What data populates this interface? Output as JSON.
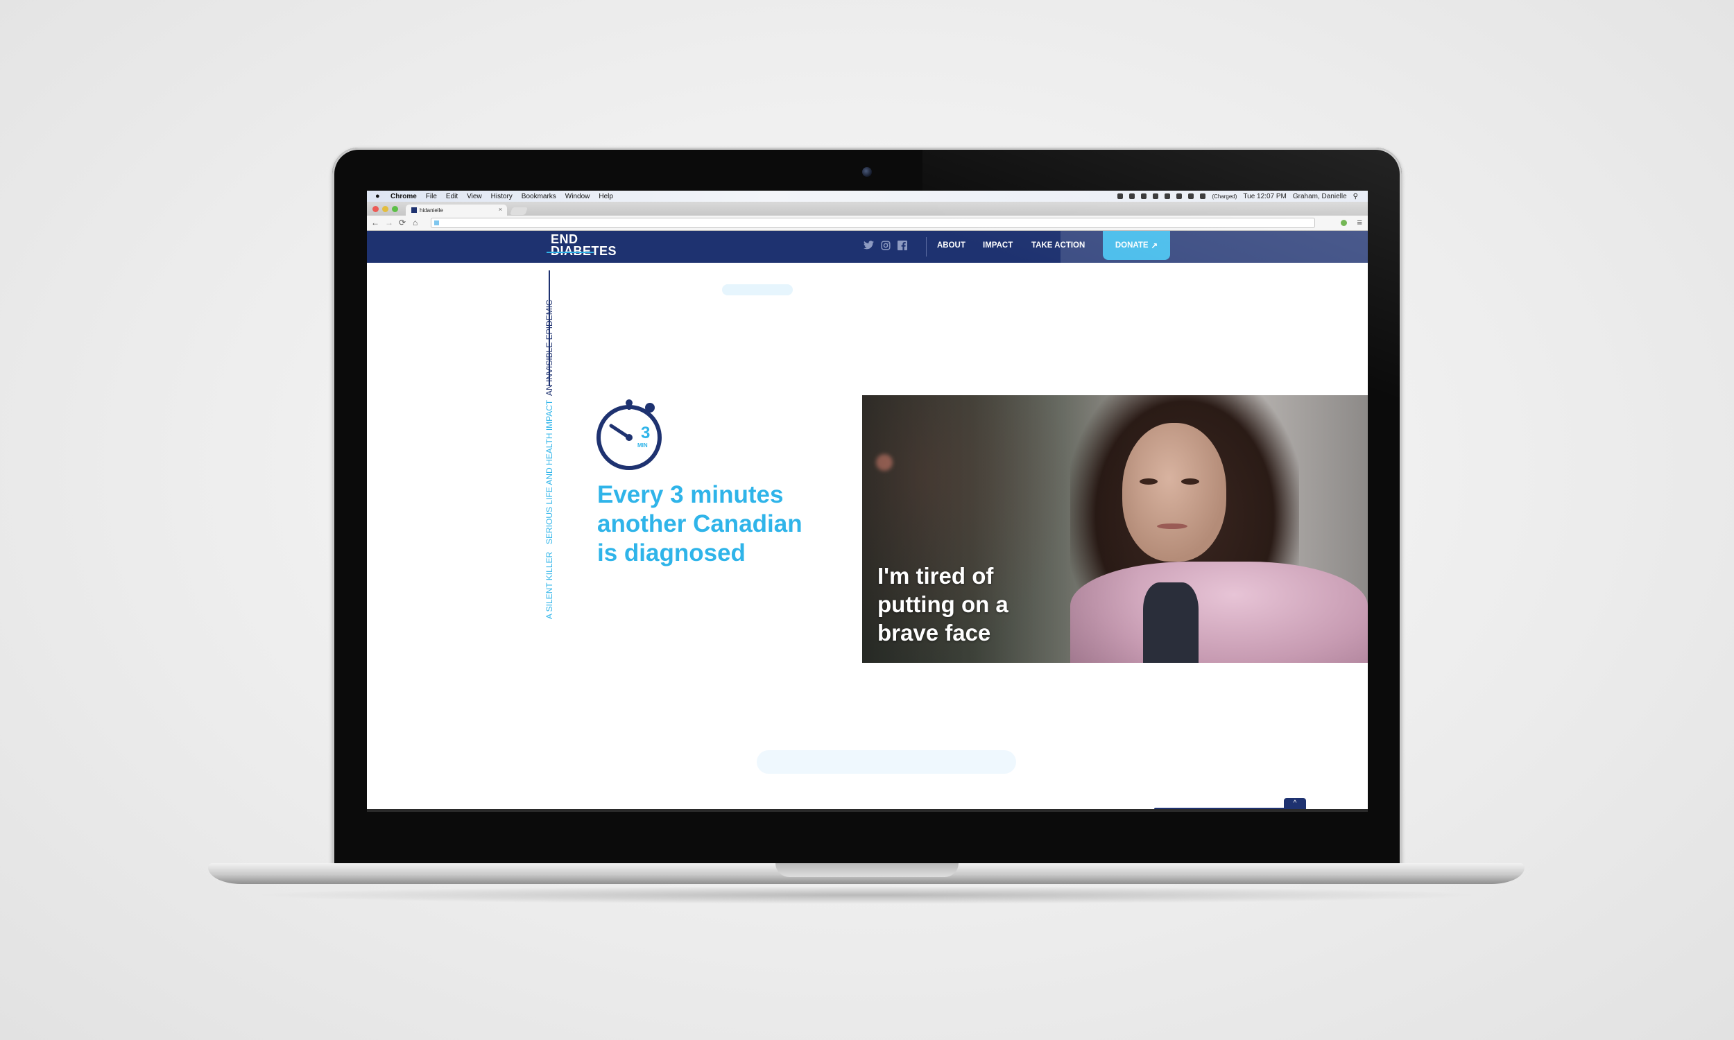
{
  "menubar": {
    "items": [
      "Chrome",
      "File",
      "Edit",
      "View",
      "History",
      "Bookmarks",
      "Window",
      "Help"
    ],
    "battery": "(Charged)",
    "clock": "Tue 12:07 PM",
    "user": "Graham, Danielle"
  },
  "browser": {
    "tab_title": "hidanielle",
    "close_glyph": "×",
    "back_glyph": "←",
    "forward_glyph": "→",
    "reload_glyph": "⟳",
    "home_glyph": "⌂",
    "menu_glyph": "≡"
  },
  "header": {
    "logo_line1": "END",
    "logo_line2": "DIABETES",
    "nav": [
      "ABOUT",
      "IMPACT",
      "TAKE ACTION"
    ],
    "donate": "DONATE",
    "donate_icon": "↗",
    "social_icons": [
      "twitter-icon",
      "instagram-icon",
      "facebook-icon"
    ],
    "brand_color": "#1e3270",
    "accent_color": "#2fb4e9"
  },
  "side_nav": {
    "items": [
      "AN INVISIBLE EPIDEMIC",
      "SERIOUS LIFE AND HEALTH IMPACT",
      "A SILENT KILLER"
    ],
    "active_index": 0
  },
  "stat": {
    "number": "3",
    "unit": "MIN",
    "headline": "Every 3 minutes another Canadian is diagnosed"
  },
  "photo": {
    "quote": "I'm tired of putting on a brave face"
  },
  "back_to_top_glyph": "^"
}
